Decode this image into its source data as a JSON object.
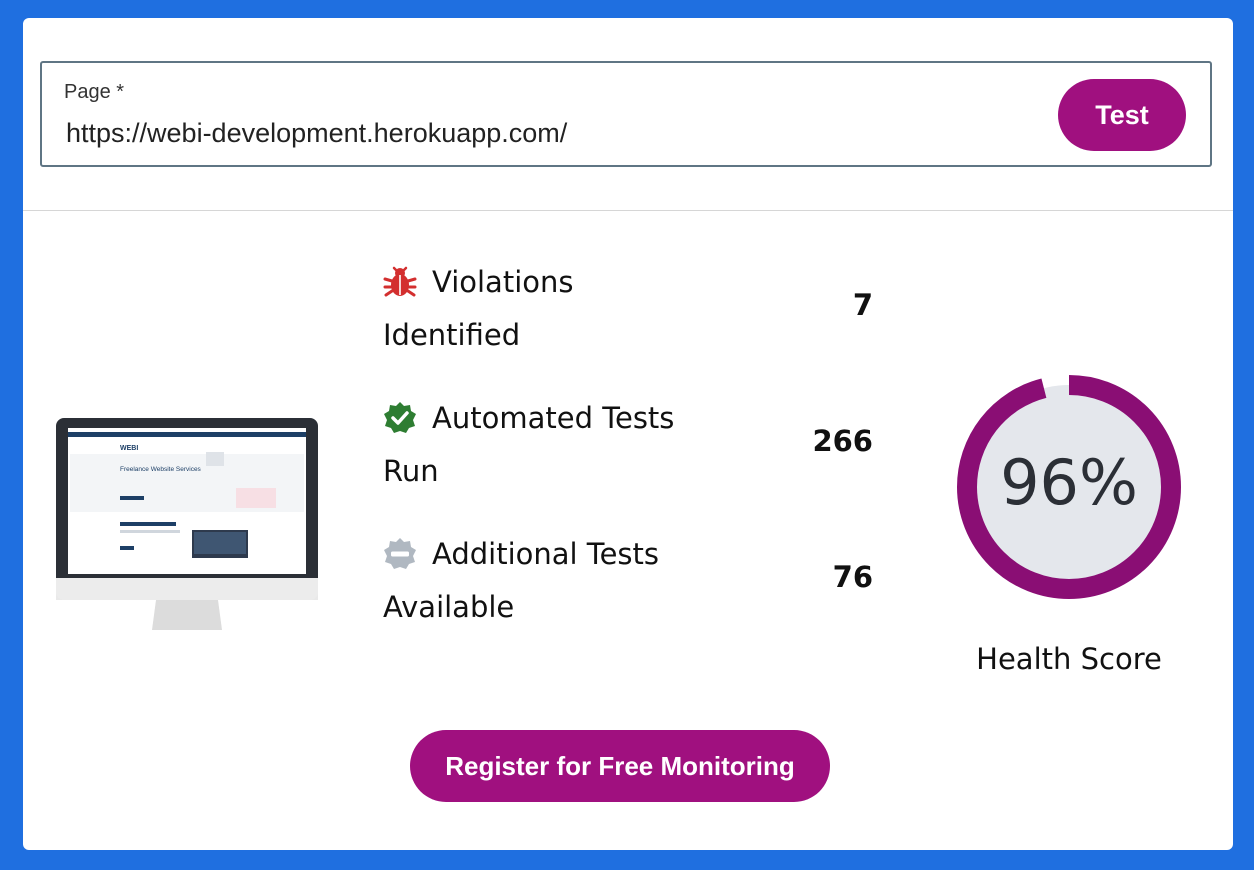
{
  "form": {
    "label": "Page *",
    "url_value": "https://webi-development.herokuapp.com/",
    "test_button": "Test"
  },
  "stats": [
    {
      "line1": "Violations",
      "line2": "Identified",
      "value": "7",
      "icon": "bug-icon",
      "icon_color": "#d32f2f"
    },
    {
      "line1": "Automated Tests",
      "line2": "Run",
      "value": "266",
      "icon": "check-badge-icon",
      "icon_color": "#2e7d32"
    },
    {
      "line1": "Additional Tests",
      "line2": "Available",
      "value": "76",
      "icon": "minus-badge-icon",
      "icon_color": "#b0b8c1"
    }
  ],
  "health": {
    "score_text": "96%",
    "score_fraction": 0.96,
    "label": "Health Score",
    "ring_color": "#8a0e74",
    "track_color": "#e4e7ec"
  },
  "preview": {
    "logo_text": "WEBI",
    "headline": "Freelance Website Services"
  },
  "register_button": "Register for Free Monitoring",
  "accent_color": "#a0107f"
}
